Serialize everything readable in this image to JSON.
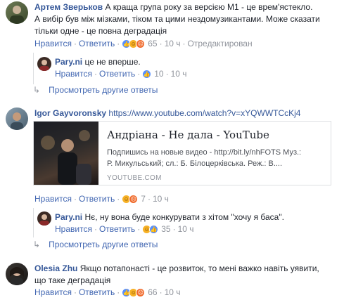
{
  "comments": [
    {
      "author": "Артем Зверьков",
      "text_line1": "А краща група року за версією М1 - це врем'ястекло.",
      "text_line2": "А вибір був між мізками, тіком та цими нездомузикантами. Може сказати",
      "text_line3": "тільки одне - це повна деградація",
      "like": "Нравится",
      "reply": "Ответить",
      "reactions_count": "65",
      "time": "10 ч",
      "edited": "Отредактирован"
    },
    {
      "author": "Pary.ni",
      "text": "це не вперше.",
      "like": "Нравится",
      "reply": "Ответить",
      "reactions_count": "10",
      "time": "10 ч"
    },
    {
      "author": "Igor Gayvoronsky",
      "text": "https://www.youtube.com/watch?v=xYQWWTCcKj4",
      "like": "Нравится",
      "reply": "Ответить",
      "reactions_count": "7",
      "time": "10 ч",
      "card": {
        "title": "Андріана - Не дала - YouTube",
        "desc_line1": "Подпишись на новые видео - http://bit.ly/nhFOTS Муз.:",
        "desc_line2": "Р. Микульський; сл.: Б. Білоцерківська. Реж.: В....",
        "domain": "YOUTUBE.COM"
      }
    },
    {
      "author": "Pary.ni",
      "text": "Нє, ну вона буде конкурувати з хітом \"хочу я баса\".",
      "like": "Нравится",
      "reply": "Ответить",
      "reactions_count": "35",
      "time": "10 ч"
    },
    {
      "author": "Olesia Zhu",
      "text_line1": "Якщо потапонасті - це розвиток, то мені важко навіть уявити,",
      "text_line2": "що таке деградація",
      "like": "Нравится",
      "reply": "Ответить",
      "reactions_count": "66",
      "time": "10 ч"
    }
  ],
  "more_replies": "Просмотреть другие ответы",
  "colors": {
    "link": "#4267b2",
    "author": "#365899",
    "meta": "#90949c"
  }
}
